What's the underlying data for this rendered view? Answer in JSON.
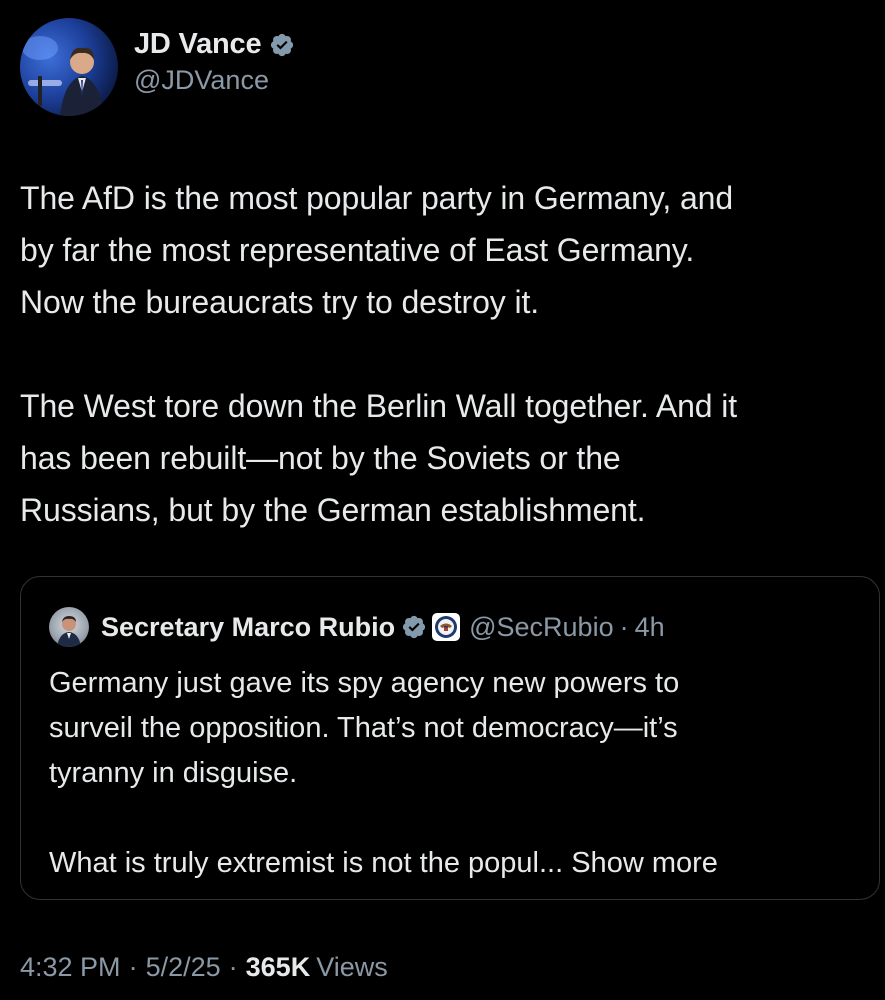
{
  "post": {
    "author": {
      "display_name": "JD Vance",
      "handle": "@JDVance",
      "avatar_icon": "profile-photo-speaker-at-podium",
      "verified_icon": "verified-badge-icon"
    },
    "paragraphs": [
      "The AfD is the most popular party in Germany, and\nby far the most representative of East Germany.\nNow the bureaucrats try to destroy it.",
      "The West tore down the Berlin Wall together. And it\nhas been rebuilt—not by the Soviets or the\nRussians, but by the German establishment."
    ],
    "time": "4:32 PM",
    "date": "5/2/25",
    "separator": "·",
    "views_count": "365K",
    "views_label": "Views"
  },
  "quoted": {
    "display_name": "Secretary Marco Rubio",
    "handle": "@SecRubio",
    "separator": "·",
    "time_ago": "4h",
    "verified_icon": "verified-badge-icon",
    "affiliate_icon": "state-department-seal-icon",
    "paragraphs": [
      "Germany just gave its spy agency new powers to\nsurveil the opposition.  That’s not democracy—it’s\ntyranny in disguise."
    ],
    "truncated_text": "What is truly extremist is not the popul...",
    "show_more_label": "Show more"
  },
  "colors": {
    "background": "#000000",
    "primary_text": "#e7e9ea",
    "secondary_text": "#8b98a5",
    "border": "#2f3336",
    "verified_blue": "#1d9bf0",
    "verified_gray": "#829aab"
  }
}
